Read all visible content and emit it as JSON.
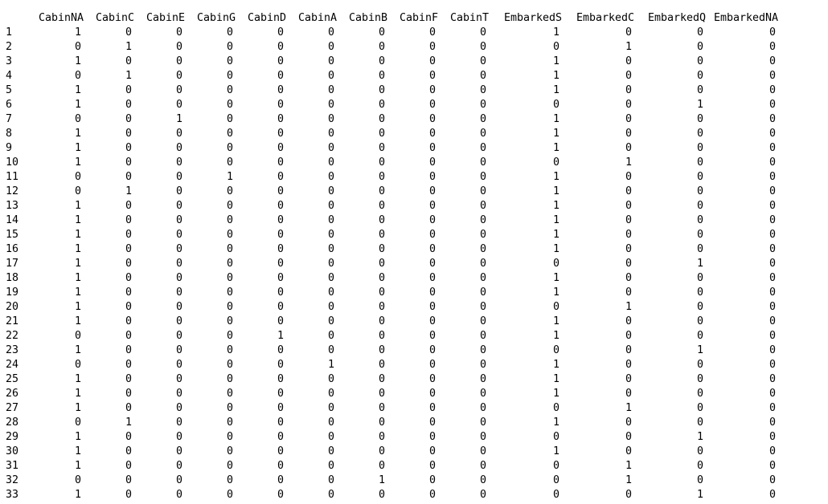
{
  "columns": [
    "CabinNA",
    "CabinC",
    "CabinE",
    "CabinG",
    "CabinD",
    "CabinA",
    "CabinB",
    "CabinF",
    "CabinT",
    "EmbarkedS",
    "EmbarkedC",
    "EmbarkedQ",
    "EmbarkedNA"
  ],
  "rows": [
    {
      "name": "1",
      "values": [
        "1",
        "0",
        "0",
        "0",
        "0",
        "0",
        "0",
        "0",
        "0",
        "1",
        "0",
        "0",
        "0"
      ]
    },
    {
      "name": "2",
      "values": [
        "0",
        "1",
        "0",
        "0",
        "0",
        "0",
        "0",
        "0",
        "0",
        "0",
        "1",
        "0",
        "0"
      ]
    },
    {
      "name": "3",
      "values": [
        "1",
        "0",
        "0",
        "0",
        "0",
        "0",
        "0",
        "0",
        "0",
        "1",
        "0",
        "0",
        "0"
      ]
    },
    {
      "name": "4",
      "values": [
        "0",
        "1",
        "0",
        "0",
        "0",
        "0",
        "0",
        "0",
        "0",
        "1",
        "0",
        "0",
        "0"
      ]
    },
    {
      "name": "5",
      "values": [
        "1",
        "0",
        "0",
        "0",
        "0",
        "0",
        "0",
        "0",
        "0",
        "1",
        "0",
        "0",
        "0"
      ]
    },
    {
      "name": "6",
      "values": [
        "1",
        "0",
        "0",
        "0",
        "0",
        "0",
        "0",
        "0",
        "0",
        "0",
        "0",
        "1",
        "0"
      ]
    },
    {
      "name": "7",
      "values": [
        "0",
        "0",
        "1",
        "0",
        "0",
        "0",
        "0",
        "0",
        "0",
        "1",
        "0",
        "0",
        "0"
      ]
    },
    {
      "name": "8",
      "values": [
        "1",
        "0",
        "0",
        "0",
        "0",
        "0",
        "0",
        "0",
        "0",
        "1",
        "0",
        "0",
        "0"
      ]
    },
    {
      "name": "9",
      "values": [
        "1",
        "0",
        "0",
        "0",
        "0",
        "0",
        "0",
        "0",
        "0",
        "1",
        "0",
        "0",
        "0"
      ]
    },
    {
      "name": "10",
      "values": [
        "1",
        "0",
        "0",
        "0",
        "0",
        "0",
        "0",
        "0",
        "0",
        "0",
        "1",
        "0",
        "0"
      ]
    },
    {
      "name": "11",
      "values": [
        "0",
        "0",
        "0",
        "1",
        "0",
        "0",
        "0",
        "0",
        "0",
        "1",
        "0",
        "0",
        "0"
      ]
    },
    {
      "name": "12",
      "values": [
        "0",
        "1",
        "0",
        "0",
        "0",
        "0",
        "0",
        "0",
        "0",
        "1",
        "0",
        "0",
        "0"
      ]
    },
    {
      "name": "13",
      "values": [
        "1",
        "0",
        "0",
        "0",
        "0",
        "0",
        "0",
        "0",
        "0",
        "1",
        "0",
        "0",
        "0"
      ]
    },
    {
      "name": "14",
      "values": [
        "1",
        "0",
        "0",
        "0",
        "0",
        "0",
        "0",
        "0",
        "0",
        "1",
        "0",
        "0",
        "0"
      ]
    },
    {
      "name": "15",
      "values": [
        "1",
        "0",
        "0",
        "0",
        "0",
        "0",
        "0",
        "0",
        "0",
        "1",
        "0",
        "0",
        "0"
      ]
    },
    {
      "name": "16",
      "values": [
        "1",
        "0",
        "0",
        "0",
        "0",
        "0",
        "0",
        "0",
        "0",
        "1",
        "0",
        "0",
        "0"
      ]
    },
    {
      "name": "17",
      "values": [
        "1",
        "0",
        "0",
        "0",
        "0",
        "0",
        "0",
        "0",
        "0",
        "0",
        "0",
        "1",
        "0"
      ]
    },
    {
      "name": "18",
      "values": [
        "1",
        "0",
        "0",
        "0",
        "0",
        "0",
        "0",
        "0",
        "0",
        "1",
        "0",
        "0",
        "0"
      ]
    },
    {
      "name": "19",
      "values": [
        "1",
        "0",
        "0",
        "0",
        "0",
        "0",
        "0",
        "0",
        "0",
        "1",
        "0",
        "0",
        "0"
      ]
    },
    {
      "name": "20",
      "values": [
        "1",
        "0",
        "0",
        "0",
        "0",
        "0",
        "0",
        "0",
        "0",
        "0",
        "1",
        "0",
        "0"
      ]
    },
    {
      "name": "21",
      "values": [
        "1",
        "0",
        "0",
        "0",
        "0",
        "0",
        "0",
        "0",
        "0",
        "1",
        "0",
        "0",
        "0"
      ]
    },
    {
      "name": "22",
      "values": [
        "0",
        "0",
        "0",
        "0",
        "1",
        "0",
        "0",
        "0",
        "0",
        "1",
        "0",
        "0",
        "0"
      ]
    },
    {
      "name": "23",
      "values": [
        "1",
        "0",
        "0",
        "0",
        "0",
        "0",
        "0",
        "0",
        "0",
        "0",
        "0",
        "1",
        "0"
      ]
    },
    {
      "name": "24",
      "values": [
        "0",
        "0",
        "0",
        "0",
        "0",
        "1",
        "0",
        "0",
        "0",
        "1",
        "0",
        "0",
        "0"
      ]
    },
    {
      "name": "25",
      "values": [
        "1",
        "0",
        "0",
        "0",
        "0",
        "0",
        "0",
        "0",
        "0",
        "1",
        "0",
        "0",
        "0"
      ]
    },
    {
      "name": "26",
      "values": [
        "1",
        "0",
        "0",
        "0",
        "0",
        "0",
        "0",
        "0",
        "0",
        "1",
        "0",
        "0",
        "0"
      ]
    },
    {
      "name": "27",
      "values": [
        "1",
        "0",
        "0",
        "0",
        "0",
        "0",
        "0",
        "0",
        "0",
        "0",
        "1",
        "0",
        "0"
      ]
    },
    {
      "name": "28",
      "values": [
        "0",
        "1",
        "0",
        "0",
        "0",
        "0",
        "0",
        "0",
        "0",
        "1",
        "0",
        "0",
        "0"
      ]
    },
    {
      "name": "29",
      "values": [
        "1",
        "0",
        "0",
        "0",
        "0",
        "0",
        "0",
        "0",
        "0",
        "0",
        "0",
        "1",
        "0"
      ]
    },
    {
      "name": "30",
      "values": [
        "1",
        "0",
        "0",
        "0",
        "0",
        "0",
        "0",
        "0",
        "0",
        "1",
        "0",
        "0",
        "0"
      ]
    },
    {
      "name": "31",
      "values": [
        "1",
        "0",
        "0",
        "0",
        "0",
        "0",
        "0",
        "0",
        "0",
        "0",
        "1",
        "0",
        "0"
      ]
    },
    {
      "name": "32",
      "values": [
        "0",
        "0",
        "0",
        "0",
        "0",
        "0",
        "1",
        "0",
        "0",
        "0",
        "1",
        "0",
        "0"
      ]
    },
    {
      "name": "33",
      "values": [
        "1",
        "0",
        "0",
        "0",
        "0",
        "0",
        "0",
        "0",
        "0",
        "0",
        "0",
        "1",
        "0"
      ]
    }
  ]
}
